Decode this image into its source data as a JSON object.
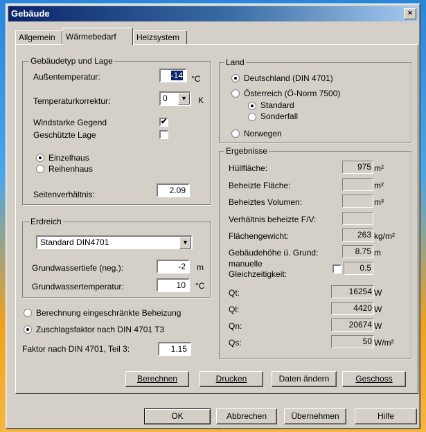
{
  "window": {
    "title": "Gebäude",
    "close_label": "×"
  },
  "tabs": [
    {
      "label": "Allgemein"
    },
    {
      "label": "Wärmebedarf"
    },
    {
      "label": "Heizsystem"
    }
  ],
  "gebaeudetyp": {
    "group_label": "Gebäudetyp und Lage",
    "aussentemp_label": "Außentemperatur:",
    "aussentemp_value": "-14",
    "aussentemp_unit": "°C",
    "tempkorr_label": "Temperaturkorrektur:",
    "tempkorr_value": "0",
    "tempkorr_unit": "K",
    "windstark_label": "Windstarke Gegend",
    "windstark_checked": "✔",
    "geschuetzt_label": "Geschützte Lage",
    "einzelhaus_label": "Einzelhaus",
    "reihenhaus_label": "Reihenhaus",
    "seitenverh_label": "Seitenverhältnis:",
    "seitenverh_value": "2.09"
  },
  "erdreich": {
    "group_label": "Erdreich",
    "select_value": "Standard DIN4701",
    "gwtiefe_label": "Grundwassertiefe (neg.):",
    "gwtiefe_value": "-2",
    "gwtiefe_unit": "m",
    "gwtemp_label": "Grundwassertemperatur:",
    "gwtemp_value": "10",
    "gwtemp_unit": "°C"
  },
  "berechnung": {
    "eingeschraenkt_label": "Berechnung eingeschränkte Beheizung",
    "zuschlag_label": "Zuschlagsfaktor nach DIN 4701 T3",
    "faktor_label": "Faktor nach DIN 4701, Teil 3:",
    "faktor_value": "1.15"
  },
  "land": {
    "group_label": "Land",
    "deutschland_label": "Deutschland (DIN 4701)",
    "oesterreich_label": "Österreich (Ö-Norm 7500)",
    "standard_label": "Standard",
    "sonderfall_label": "Sonderfall",
    "norwegen_label": "Norwegen"
  },
  "ergebnisse": {
    "group_label": "Ergebnisse",
    "rows": [
      {
        "label": "Hüllfläche:",
        "value": "975",
        "unit": "m²"
      },
      {
        "label": "Beheizte Fläche:",
        "value": "",
        "unit": "m²"
      },
      {
        "label": "Beheiztes Volumen:",
        "value": "",
        "unit": "m³"
      },
      {
        "label": "Verhältnis beheizte F/V:",
        "value": "",
        "unit": ""
      },
      {
        "label": "Flächengewicht:",
        "value": "263",
        "unit": "kg/m²"
      },
      {
        "label": "Gebäudehöhe ü. Grund:",
        "value": "8.75",
        "unit": "m"
      }
    ],
    "gleichzeitigkeit_label_1": "manuelle",
    "gleichzeitigkeit_label_2": "Gleichzeitigkeit:",
    "gleichzeitigkeit_value": "0.5",
    "q_rows": [
      {
        "label": "Qt:",
        "value": "16254",
        "unit": "W"
      },
      {
        "label": "Ql:",
        "value": "4420",
        "unit": "W"
      },
      {
        "label": "Qn:",
        "value": "20674",
        "unit": "W"
      },
      {
        "label": "Qs:",
        "value": "50",
        "unit": "W/m²"
      }
    ]
  },
  "actions": {
    "berechnen": "Berechnen",
    "drucken": "Drucken",
    "daten_aendern": "Daten ändern",
    "geschoss": "Geschoss"
  },
  "footer": {
    "ok": "OK",
    "abbrechen": "Abbrechen",
    "uebernehmen": "Übernehmen",
    "hilfe": "Hilfe"
  }
}
